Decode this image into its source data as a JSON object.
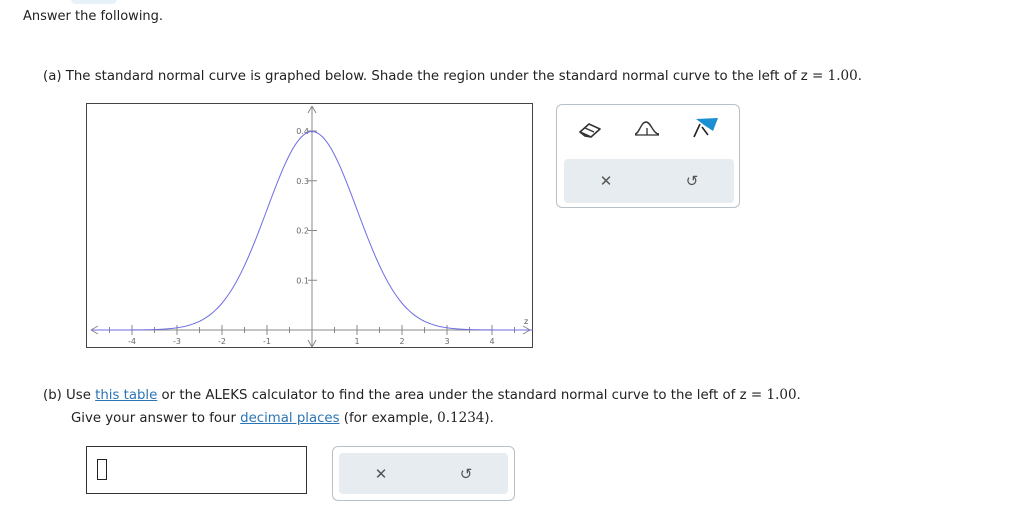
{
  "instructions": "Answer the following.",
  "part_a": {
    "text_before": "(a) The standard normal curve is graphed below. Shade the region under the standard normal curve to the left of z",
    "equals": " = ",
    "z_value": "1.00",
    "end": "."
  },
  "graph": {
    "x_axis_label": "z",
    "x_tick_labels": [
      "-4",
      "-3",
      "-2",
      "-1",
      "1",
      "2",
      "3",
      "4"
    ],
    "y_tick_labels": [
      "0.1",
      "0.2",
      "0.3",
      "0.4"
    ]
  },
  "chart_data": {
    "type": "line",
    "title": "",
    "xlabel": "z",
    "ylabel": "",
    "xlim": [
      -4.9,
      4.9
    ],
    "ylim": [
      0,
      0.42
    ],
    "x_ticks": [
      -4,
      -3,
      -2,
      -1,
      1,
      2,
      3,
      4
    ],
    "y_ticks": [
      0.1,
      0.2,
      0.3,
      0.4
    ],
    "series": [
      {
        "function": "standard normal density",
        "x": [
          -4,
          -3.5,
          -3,
          -2.5,
          -2,
          -1.5,
          -1,
          -0.5,
          0,
          0.5,
          1,
          1.5,
          2,
          2.5,
          3,
          3.5,
          4
        ],
        "y": [
          0.0001,
          0.0009,
          0.0044,
          0.0175,
          0.054,
          0.1295,
          0.242,
          0.3521,
          0.3989,
          0.3521,
          0.242,
          0.1295,
          0.054,
          0.0175,
          0.0044,
          0.0009,
          0.0001
        ]
      }
    ],
    "grid": false,
    "shaded_region": null,
    "colors": {
      "curve": "#6c6ce6",
      "axis": "#888888"
    }
  },
  "tools": {
    "icons": [
      "eraser-icon",
      "curve-tool-icon",
      "shade-region-icon"
    ],
    "clear_symbol": "✕",
    "undo_symbol": "↺"
  },
  "part_b": {
    "line1_prefix": "(b) Use ",
    "link_table": "this table",
    "line1_mid": " or the ALEKS calculator to find the area under the standard normal curve to the left of z",
    "equals": " = ",
    "z_value": "1.00",
    "end": ".",
    "line2_prefix": "Give your answer to four ",
    "link_decimal": "decimal places",
    "line2_mid": " (for example, ",
    "example": "0.1234",
    "line2_end": ")."
  },
  "answer": {
    "value": "",
    "clear_symbol": "✕",
    "undo_symbol": "↺"
  }
}
